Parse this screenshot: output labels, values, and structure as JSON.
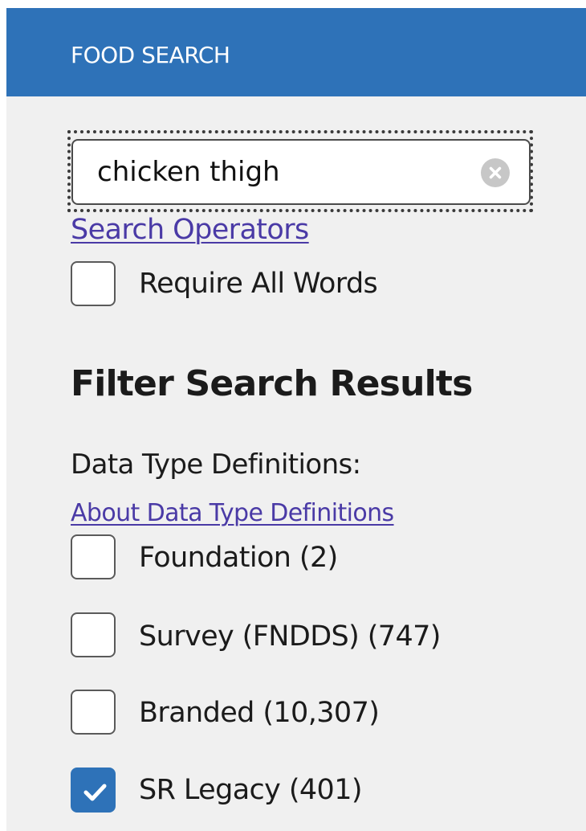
{
  "header": {
    "title": "FOOD SEARCH"
  },
  "search": {
    "value": "chicken thigh",
    "clear_icon": "clear-circle-x-icon",
    "operators_link": "Search Operators",
    "require_all_words": {
      "label": "Require All Words",
      "checked": false
    }
  },
  "filters": {
    "title": "Filter Search Results",
    "data_type_heading": "Data Type Definitions:",
    "about_link": "About Data Type Definitions",
    "options": [
      {
        "label": "Foundation (2)",
        "checked": false
      },
      {
        "label": "Survey (FNDDS) (747)",
        "checked": false
      },
      {
        "label": "Branded (10,307)",
        "checked": false
      },
      {
        "label": "SR Legacy (401)",
        "checked": true
      }
    ]
  },
  "colors": {
    "brand_blue": "#2e72b8",
    "link_purple": "#4a3aa6",
    "panel_bg": "#f0f0f0"
  }
}
